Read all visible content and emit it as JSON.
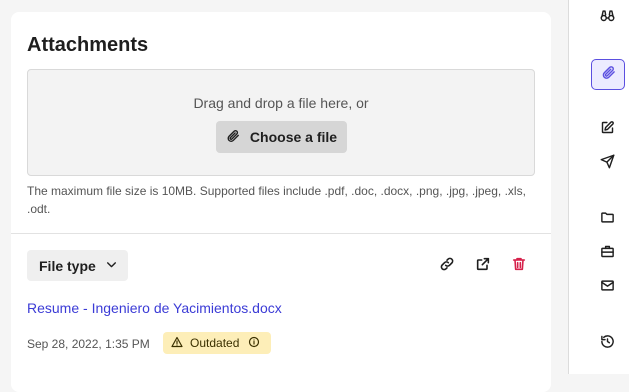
{
  "attachments": {
    "title": "Attachments",
    "dropzone_text": "Drag and drop a file here, or",
    "choose_label": "Choose a file",
    "help_text": "The maximum file size is 10MB. Supported files include .pdf, .doc, .docx, .png, .jpg, .jpeg, .xls, .odt."
  },
  "file": {
    "type_label": "File type",
    "name": "Resume - Ingeniero de Yacimientos.docx",
    "date": "Sep 28, 2022, 1:35 PM",
    "status": "Outdated",
    "actions": [
      "link-icon",
      "external-link-icon",
      "trash-icon"
    ]
  },
  "colors": {
    "link": "#3b3bd6",
    "delete": "#d6204a",
    "badge_bg": "#fdeeb8",
    "active_rail": "#5b4fe0"
  },
  "rail": {
    "icons": [
      "binoculars-icon",
      "paperclip-icon",
      "edit-icon",
      "send-icon",
      "folder-icon",
      "briefcase-icon",
      "mail-icon",
      "history-icon"
    ],
    "active": "paperclip-icon"
  }
}
